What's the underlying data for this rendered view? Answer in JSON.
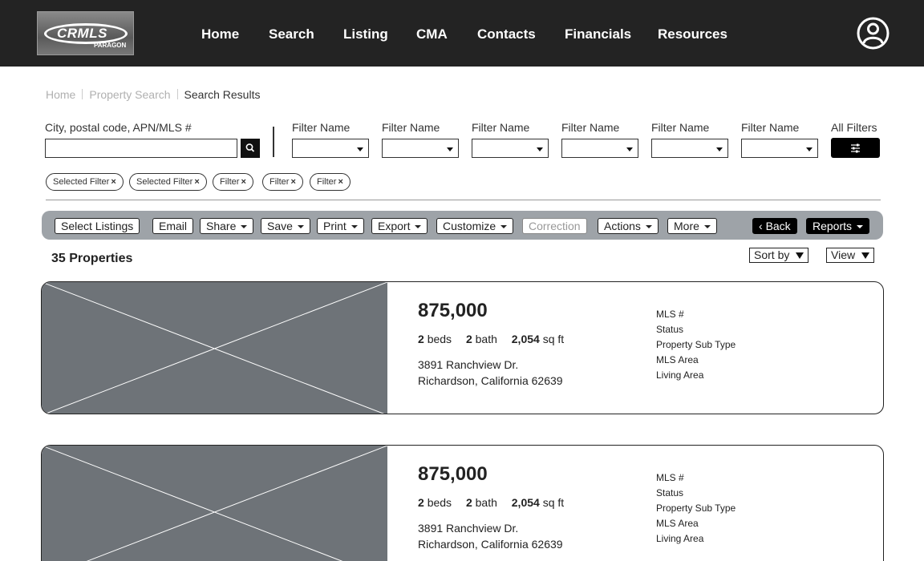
{
  "brand": {
    "logo_text": "CRMLS",
    "logo_sub": "PARAGON"
  },
  "nav": {
    "items": [
      "Home",
      "Search",
      "Listing",
      "CMA",
      "Contacts",
      "Financials",
      "Resources"
    ]
  },
  "breadcrumb": {
    "items": [
      "Home",
      "Property Search",
      "Search Results"
    ]
  },
  "search": {
    "label": "City, postal code, APN/MLS #",
    "value": "",
    "placeholder": ""
  },
  "filters": {
    "labels": [
      "Filter Name",
      "Filter Name",
      "Filter Name",
      "Filter Name",
      "Filter Name",
      "Filter Name"
    ],
    "all_filters_label": "All Filters"
  },
  "chips": [
    "Selected Filter",
    "Selected Filter",
    "Filter",
    "Filter",
    "Filter"
  ],
  "toolbar": {
    "buttons": [
      "Select Listings",
      "Email",
      "Share",
      "Save",
      "Print",
      "Export",
      "Customize",
      "Correction",
      "Actions",
      "More"
    ],
    "back_label": "Back",
    "reports_label": "Reports"
  },
  "results": {
    "count": "35",
    "count_label": "Properties",
    "sort_label": "Sort by",
    "view_label": "View"
  },
  "listings": [
    {
      "price": "875,000",
      "beds": "2",
      "beds_label": "beds",
      "baths": "2",
      "baths_label": "bath",
      "sqft": "2,054",
      "sqft_label": "sq ft",
      "address_line1": "3891 Ranchview Dr.",
      "address_line2": "Richardson, California 62639",
      "fields": [
        "MLS #",
        "Status",
        "Property Sub Type",
        "MLS Area",
        "Living Area"
      ]
    },
    {
      "price": "875,000",
      "beds": "2",
      "beds_label": "beds",
      "baths": "2",
      "baths_label": "bath",
      "sqft": "2,054",
      "sqft_label": "sq ft",
      "address_line1": "3891 Ranchview Dr.",
      "address_line2": "Richardson, California 62639",
      "fields": [
        "MLS #",
        "Status",
        "Property Sub Type",
        "MLS Area",
        "Living Area"
      ]
    }
  ],
  "colors": {
    "topbar": "#232323",
    "toolbar": "#9ea3a8",
    "image_placeholder": "#6e7378"
  }
}
